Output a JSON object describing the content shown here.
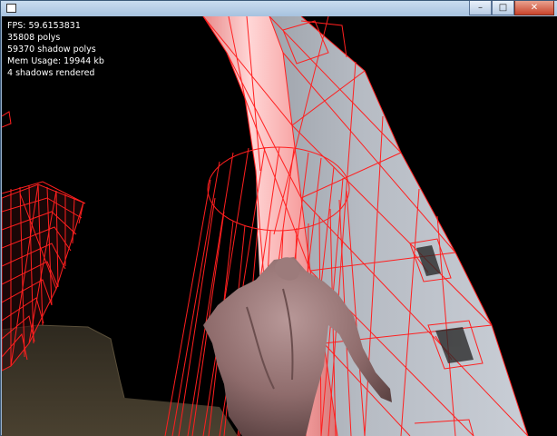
{
  "window": {
    "title": "",
    "controls": {
      "minimize": "–",
      "maximize": "□",
      "close": "✕"
    }
  },
  "hud": {
    "fps": "FPS: 59.6153831",
    "polys": "35808 polys",
    "shadow_polys": "59370 shadow polys",
    "mem_usage": "Mem Usage: 19944 kb",
    "shadows_rendered": "4 shadows rendered"
  },
  "colors": {
    "wireframe": "#ff1f1f",
    "background": "#000000",
    "pillar_lit": "#ffb6b6",
    "pillar_shade": "#a9aeb6",
    "ground": "#3a3226"
  }
}
